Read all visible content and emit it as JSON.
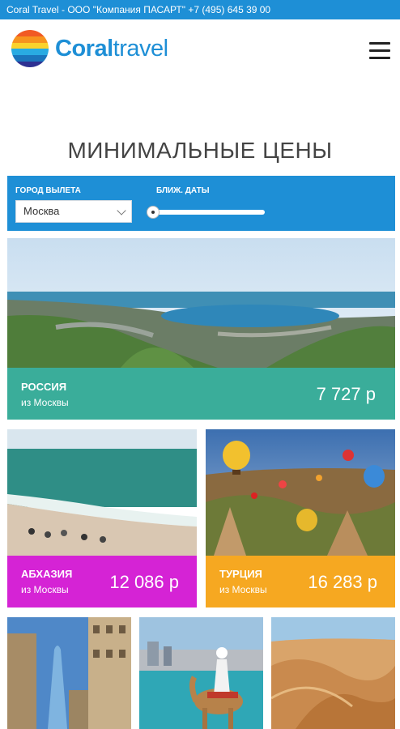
{
  "topbar": {
    "text": "Coral Travel - ООО \"Компания ПАСАРТ\" +7 (495) 645 39 00"
  },
  "brand": {
    "bold": "Coral",
    "light": "travel",
    "color": "#1e8fd6"
  },
  "section_title": "МИНИМАЛЬНЫЕ ЦЕНЫ",
  "filter": {
    "city_label": "ГОРОД ВЫЛЕТА",
    "city_value": "Москва",
    "dates_label": "БЛИЖ. ДАТЫ"
  },
  "offers": [
    {
      "country": "РОССИЯ",
      "from": "из Москвы",
      "price": "7 727 р",
      "band_color": "#3aad9a"
    },
    {
      "country": "АБХАЗИЯ",
      "from": "из Москвы",
      "price": "12 086 р",
      "band_color": "#d523d5"
    },
    {
      "country": "ТУРЦИЯ",
      "from": "из Москвы",
      "price": "16 283 р",
      "band_color": "#f6a821"
    }
  ]
}
